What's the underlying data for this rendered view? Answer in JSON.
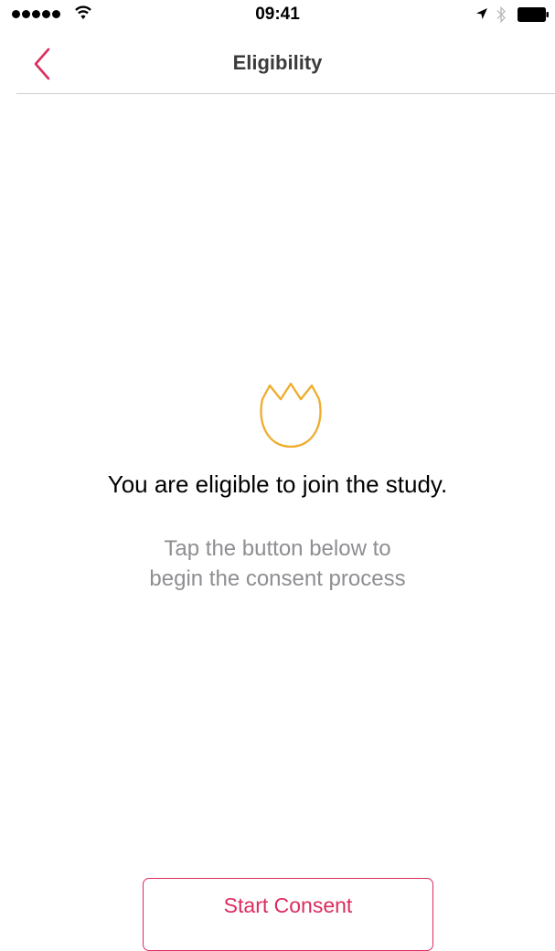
{
  "status_bar": {
    "time": "09:41",
    "signal_icon": "signal-dots-icon",
    "wifi_icon": "wifi-icon",
    "location_icon": "location-arrow-icon",
    "bluetooth_icon": "bluetooth-icon",
    "battery_icon": "battery-full-icon"
  },
  "nav": {
    "title": "Eligibility",
    "back_icon": "chevron-left-icon"
  },
  "content": {
    "icon": "tulip-icon",
    "headline": "You are eligible to join the study.",
    "subtext_line1": "Tap the button below to",
    "subtext_line2": "begin the consent process"
  },
  "actions": {
    "start_consent_label": "Start Consent"
  },
  "colors": {
    "accent": "#dc2c5f",
    "icon_orange": "#f0ab2a",
    "title_gray": "#3b3b3b",
    "subtext_gray": "#8e8e93",
    "divider": "#cfcfcf"
  }
}
